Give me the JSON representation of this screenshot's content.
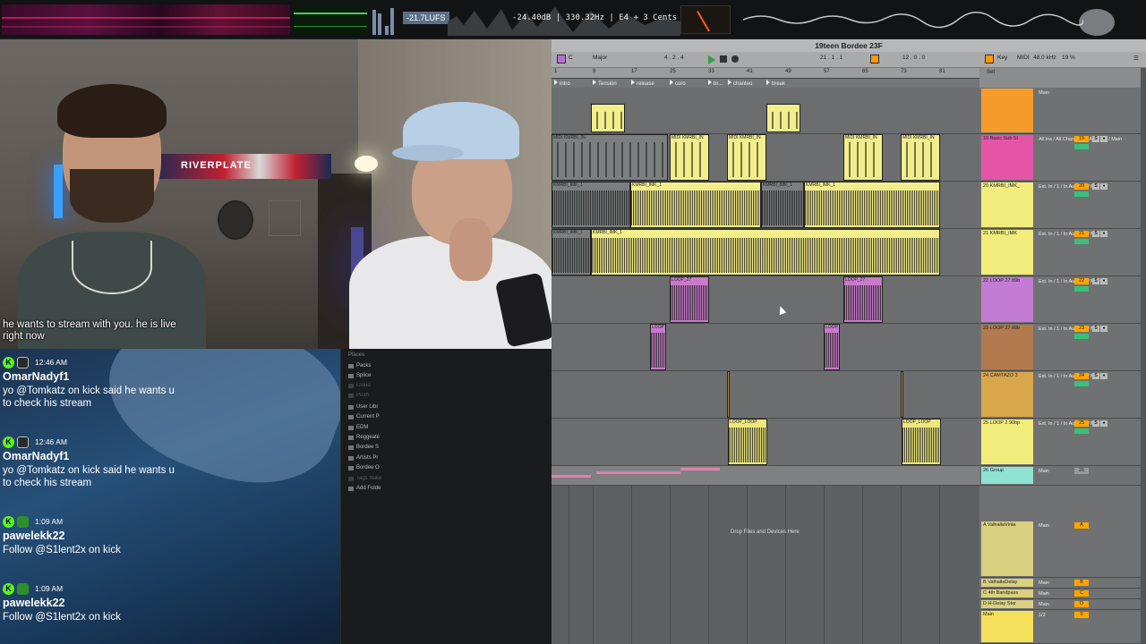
{
  "overlay": {
    "lufs": "-21.7LUFS",
    "tuner": "-24.40dB  |  330.32Hz  |  E4   + 3 Cents"
  },
  "webcam": {
    "flag_text": "RIVERPLATE",
    "caption": "he wants to stream with you. he is live right now"
  },
  "chat": {
    "messages": [
      {
        "time": "12:46 AM",
        "user": "OmarNadyf1",
        "text": "yo @Tomkatz on kick said he wants u to check his stream"
      },
      {
        "time": "12:46 AM",
        "user": "OmarNadyf1",
        "text": "yo @Tomkatz on kick said he wants u to check his stream"
      },
      {
        "time": "1:09 AM",
        "user": "pawelekk22",
        "text": "Follow @S1lent2x on kick"
      },
      {
        "time": "1:09 AM",
        "user": "pawelekk22",
        "text": "Follow @S1lent2x on kick"
      }
    ]
  },
  "browser": {
    "title": "Places",
    "items": [
      "Packs",
      "Splice",
      "Cloud",
      "Push",
      "User Libr",
      "Current P",
      "EDM",
      "Reggeaté",
      "Bordee S",
      "Artists Pr",
      "Bordee O",
      "Tags Nuke",
      "Add Folde"
    ]
  },
  "daw": {
    "title": "19teen Bordee 23F",
    "control": {
      "key": "C",
      "scale": "Major",
      "position": "4 .  2 .  4",
      "loop_start": "21 .  1 .  1",
      "loop_len": "12 .  0 .  0",
      "key_label": "Key",
      "midi_label": "MIDI",
      "sample_rate": "48.0 kHz",
      "cpu": "19 %"
    },
    "ruler": [
      "1",
      "9",
      "17",
      "25",
      "33",
      "41",
      "49",
      "57",
      "65",
      "73",
      "81"
    ],
    "locators": [
      "intro",
      "Tensión",
      "release",
      "coro",
      "br...",
      "chanteo",
      "break"
    ],
    "drop_text": "Drop Files and Devices Here",
    "set_label": "Set",
    "tracks": [
      {
        "name": "",
        "color": "#f59b2a",
        "io": "Main",
        "num": "",
        "clip_label": ""
      },
      {
        "name": "19 Basic Sub Sl",
        "color": "#e455a8",
        "io": "All Ins / All Channe / In Auto Off / Main",
        "num": "19",
        "clip_label": "MIDI KMRBI_IN"
      },
      {
        "name": "20 KMRBI_IMK_",
        "color": "#f2ec7c",
        "io": "Ext. In / 1 / In Auto Off / Main",
        "num": "20",
        "clip_label": "KMRBI_IMK_1"
      },
      {
        "name": "21 KMRBI_IMK",
        "color": "#f2ec7c",
        "io": "Ext. In / 1 / In Auto Off / Main",
        "num": "21",
        "clip_label": "KMRBI_IMK_1"
      },
      {
        "name": "22 LOOP 27 89b",
        "color": "#c37bd3",
        "io": "Ext. In / 1 / In Auto Off / Main",
        "num": "22",
        "clip_label": "LOOP_27"
      },
      {
        "name": "23 LOOP 27 89b",
        "color": "#b27a4e",
        "io": "Ext. In / 1 / In Auto Off / Main",
        "num": "23",
        "clip_label": "LOOP"
      },
      {
        "name": "24 CAMTAZO 3",
        "color": "#d8a64b",
        "io": "Ext. In / 1 / In Auto Off / Main",
        "num": "24",
        "clip_label": ""
      },
      {
        "name": "25 LOOP 2 90bp",
        "color": "#f2ec7c",
        "io": "Ext. In / 1 / In Auto Off / Main",
        "num": "25",
        "clip_label": "LOOP_LOOP"
      },
      {
        "name": "26 Group",
        "color": "#8de2d0",
        "io": "Main",
        "num": "26",
        "clip_label": ""
      }
    ],
    "returns": [
      {
        "name": "A ValhallaVinta",
        "color": "#d9d080",
        "io": "Main",
        "num": "A"
      },
      {
        "name": "B ValhallaDelay",
        "color": "#d9d080",
        "io": "Main",
        "num": "B"
      },
      {
        "name": "C 4th Bandpass",
        "color": "#d9d080",
        "io": "Main",
        "num": "C"
      },
      {
        "name": "D H-Delay Ster",
        "color": "#d9d080",
        "io": "Main",
        "num": "D"
      },
      {
        "name": "Main",
        "color": "#f4e05a",
        "io": "1/2",
        "num": "0"
      }
    ]
  }
}
